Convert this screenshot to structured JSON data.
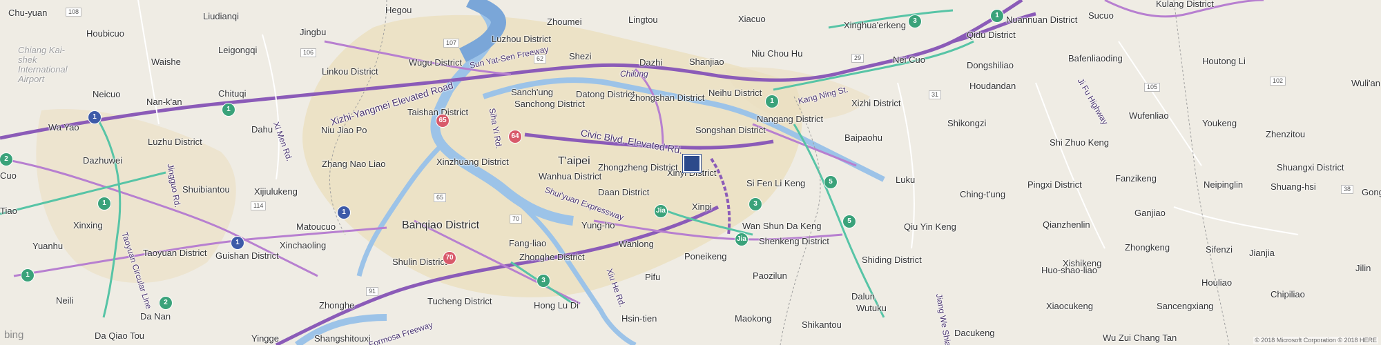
{
  "map": {
    "labels_major": [
      "T'aipei",
      "Banqiao District",
      "Xinyi District"
    ],
    "labels_minor": [
      "Chu-yuan",
      "Houbicuo",
      "Liudianqi",
      "Hegou",
      "Zhoumei",
      "Lingtou",
      "Xiacuo",
      "Xinghua'erkeng",
      "Qidu District",
      "Nuannuan District",
      "Sucuo",
      "Kulang District",
      "Jingbu",
      "Luzhou District",
      "Shezi",
      "Dazhi",
      "Shanjiao",
      "Niu Chou Hu",
      "Nei Cuo",
      "Dongshiliao",
      "Bafenliaoding",
      "Houtong Li",
      "Waishe",
      "Leigongqi",
      "Wugu District",
      "Linkou District",
      "Neicuo",
      "Chituqi",
      "Sanch'ung",
      "Sanchong District",
      "Datong District",
      "Zhongshan District",
      "Neihu District",
      "Xizhi District",
      "Houdandan",
      "Wuli'an",
      "Nan-k'an",
      "Taishan District",
      "Nangang District",
      "Wa Yao",
      "Dahu",
      "Niu Jiao Po",
      "Songshan District",
      "Baipaohu",
      "Shikongzi",
      "Wufenliao",
      "Youkeng",
      "Zhenzitou",
      "Luzhu District",
      "Shi Zhuo Keng",
      "Zhang Nao Liao",
      "Xinzhuang District",
      "Zhongzheng District",
      "Shuangxi District",
      "Shuang-hsi",
      "Dazhuwei",
      "Shuibiantou",
      "Xijiulukeng",
      "Wanhua District",
      "Daan District",
      "Si Fen Li Keng",
      "Luku",
      "Pingxi District",
      "Fanzikeng",
      "Neipinglin",
      "Ching-t'ung",
      "Xinxing",
      "Matoucuo",
      "Xinpi",
      "Ganjiao",
      "Yuanhu",
      "Fang-liao",
      "Yung-ho",
      "Wan Shun Da Keng",
      "Qiu Yin Keng",
      "Qianzhenlin",
      "Xinchaoling",
      "Wanlong",
      "Shenkeng District",
      "Jianjia",
      "Taoyuan District",
      "Guishan District",
      "Poneikeng",
      "Xishikeng",
      "Zhongkeng",
      "Sifenzi",
      "Shulin District",
      "Zhonghe District",
      "Shiding District",
      "Huo-shao-liao",
      "Paozilun",
      "Houliao",
      "Pifu",
      "Chipiliao",
      "Dalun",
      "Neili",
      "Zhonghe",
      "Tucheng District",
      "Hong Lu Di",
      "Wutuku",
      "Xiaocukeng",
      "Sancengxiang",
      "Da Nan",
      "Hsin-tien",
      "Maokong",
      "Shikantou",
      "Dacukeng",
      "Da Qiao Tou",
      "Yingge",
      "Shangshitouxi",
      "Wu Zui Chang Tan",
      "Jilin",
      "Gongliao",
      "Tiao",
      "Cuo",
      "Chiang Kai-shek International Airport"
    ],
    "road_labels": [
      "Sun Yat-Sen Freeway",
      "Xizhi-Yangmei Elevated Road",
      "Civic Blvd. Elevated Rd.",
      "Kang Ning St.",
      "Jingguo Rd.",
      "Shui'yuan Expressway",
      "Formosa Freeway",
      "Taoyuan Circular Line",
      "Ji Fu Highway",
      "Jiang We Shian",
      "Siha Yi Rd.",
      "Xi Men Rd.",
      "Xiu He Rd.",
      "Chilung",
      "Jia"
    ],
    "shields": [
      "108",
      "107",
      "106",
      "62",
      "29",
      "31",
      "102",
      "1",
      "3",
      "5",
      "2",
      "64",
      "65",
      "70",
      "91",
      "114",
      "105",
      "106",
      "38",
      "Jia"
    ],
    "pin_label": "location-pin",
    "logo_text": "bing",
    "copyright": "© 2018 Microsoft Corporation © 2018 HERE",
    "colors": {
      "land": "#efece4",
      "urban": "#e8dfc4",
      "river": "#9cc3e8",
      "river_dark": "#7aa6d8",
      "freeway": "#8b5bb8",
      "highway": "#b77fd0",
      "expressway": "#57c4a6",
      "pin": "#2c4a8b"
    }
  }
}
